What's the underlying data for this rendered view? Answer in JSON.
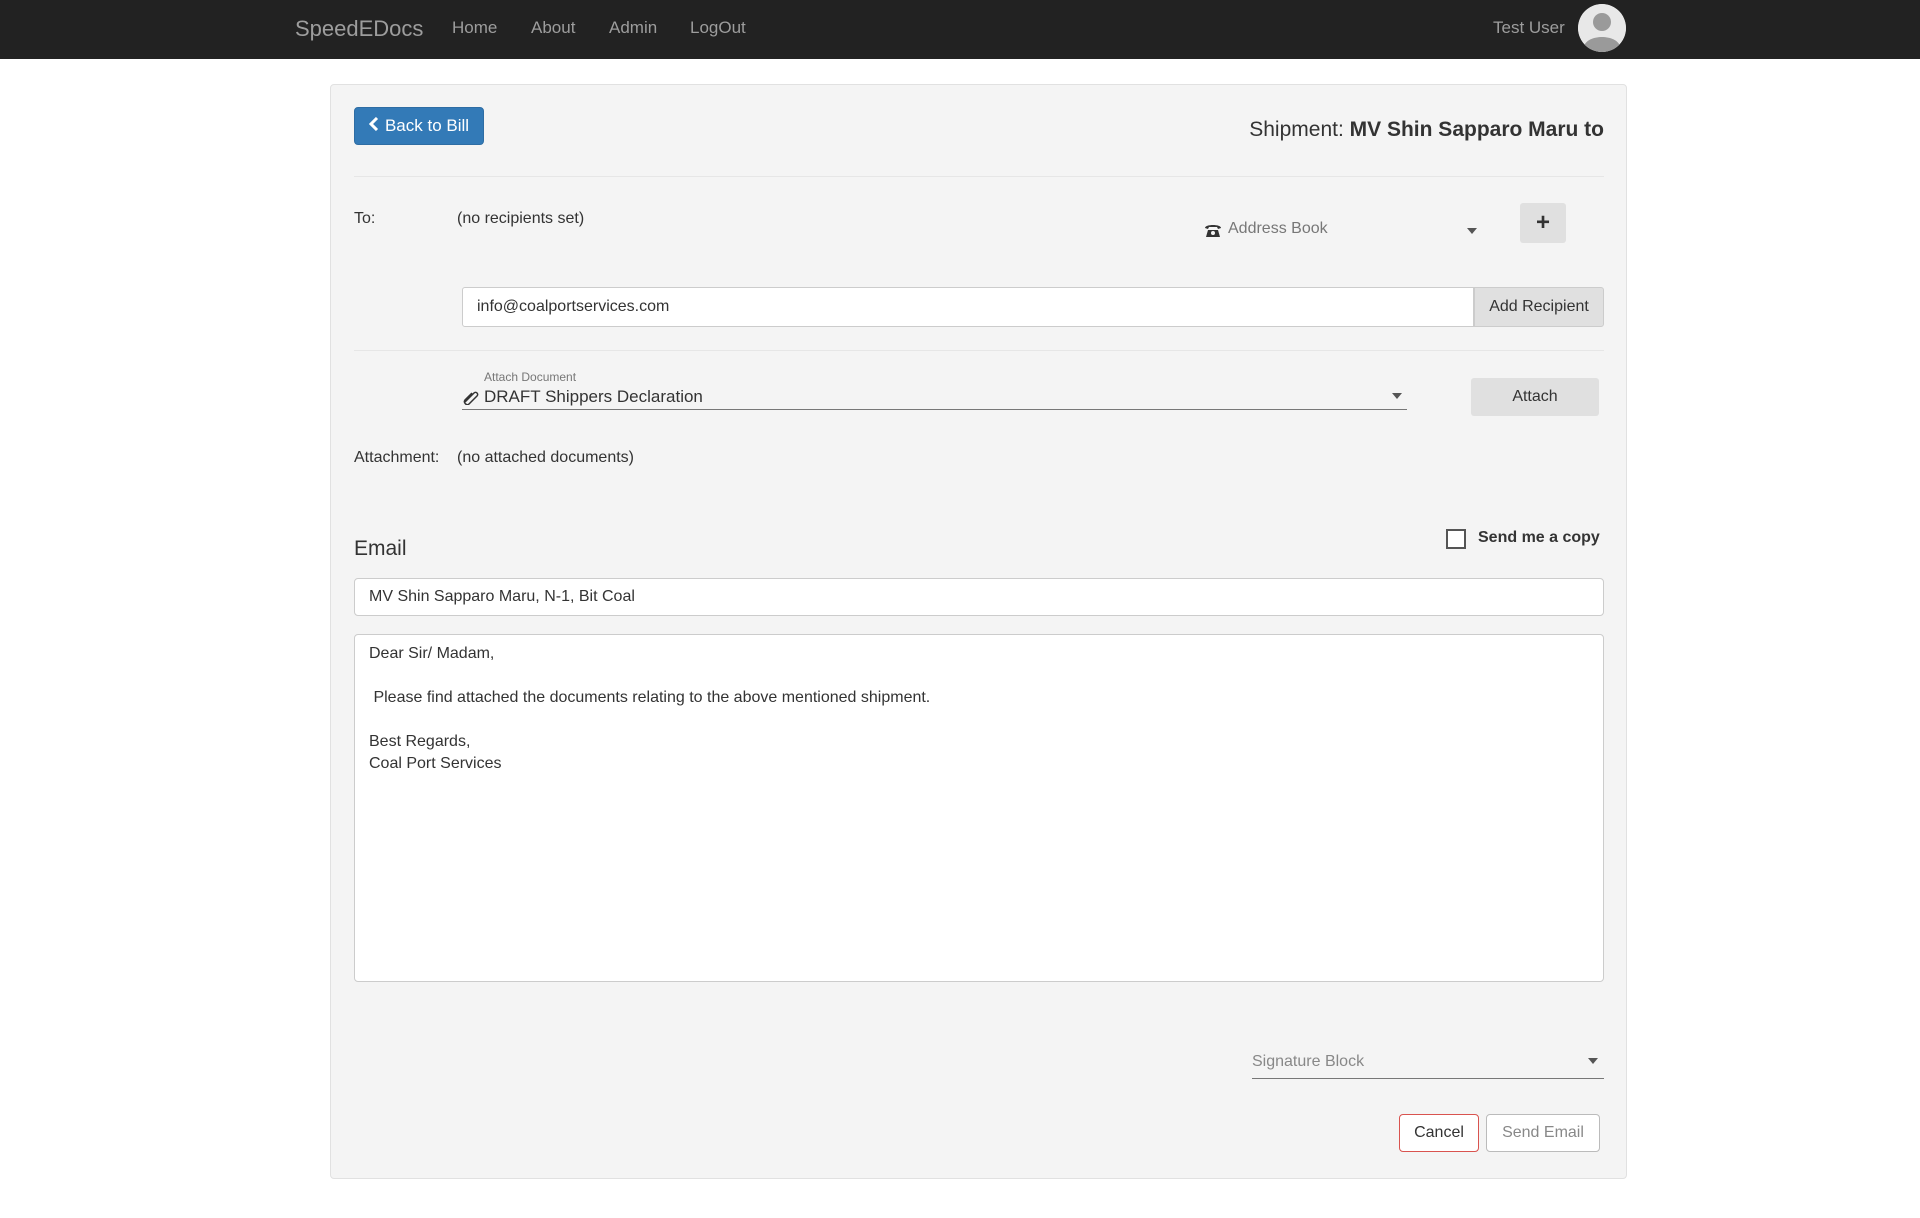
{
  "nav": {
    "brand": "SpeedEDocs",
    "links": [
      "Home",
      "About",
      "Admin",
      "LogOut"
    ],
    "user": "Test User"
  },
  "header": {
    "back_label": "Back to Bill",
    "shipment_prefix": "Shipment:",
    "shipment_name": "MV Shin Sapparo Maru to"
  },
  "recipients": {
    "to_label": "To:",
    "to_value": "(no recipients set)",
    "address_book": "Address Book",
    "plus_symbol": "+",
    "email_value": "info@coalportservices.com",
    "add_button": "Add Recipient"
  },
  "attach": {
    "field_label": "Attach Document",
    "selected": "DRAFT Shippers Declaration",
    "button": "Attach",
    "attachment_label": "Attachment:",
    "attachment_value": "(no attached documents)"
  },
  "email": {
    "heading": "Email",
    "copy_label": "Send me a copy",
    "copy_checked": false,
    "subject": "MV Shin Sapparo Maru, N-1, Bit Coal",
    "body_lines": [
      "Dear Sir/ Madam,",
      "",
      " Please find attached the documents relating to the above mentioned shipment.",
      "",
      "Best Regards,",
      "Coal Port Services"
    ],
    "signature_placeholder": "Signature Block",
    "cancel": "Cancel",
    "send": "Send Email"
  }
}
